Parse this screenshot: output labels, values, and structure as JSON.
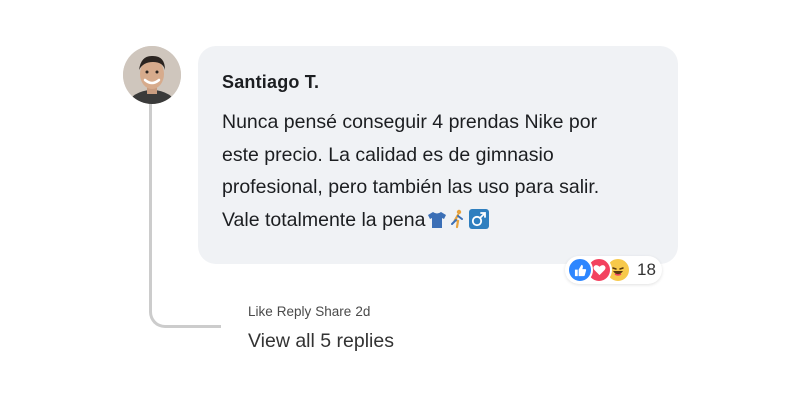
{
  "comment": {
    "author": "Santiago T.",
    "text_lines": [
      "Nunca pensé conseguir 4 prendas Nike por",
      "este precio. La calidad es de gimnasio",
      "profesional, pero también las uso para salir.",
      "Vale totalmente la pena"
    ],
    "trailing_emojis": [
      "tshirt-emoji",
      "runner-emoji",
      "male-sign-emoji"
    ]
  },
  "reactions": {
    "icons": [
      "like-icon",
      "love-icon",
      "haha-icon"
    ],
    "count": "18",
    "colors": {
      "like": "#2d86ff",
      "love": "#f3425f",
      "haha": "#f7c94b"
    }
  },
  "actions": {
    "like": "Like",
    "reply": "Reply",
    "share": "Share",
    "time": "2d"
  },
  "replies": {
    "view_all": "View all 5 replies"
  },
  "colors": {
    "bubble": "#f0f2f5",
    "thread_line": "#cccccc",
    "text": "#1c1e21"
  }
}
